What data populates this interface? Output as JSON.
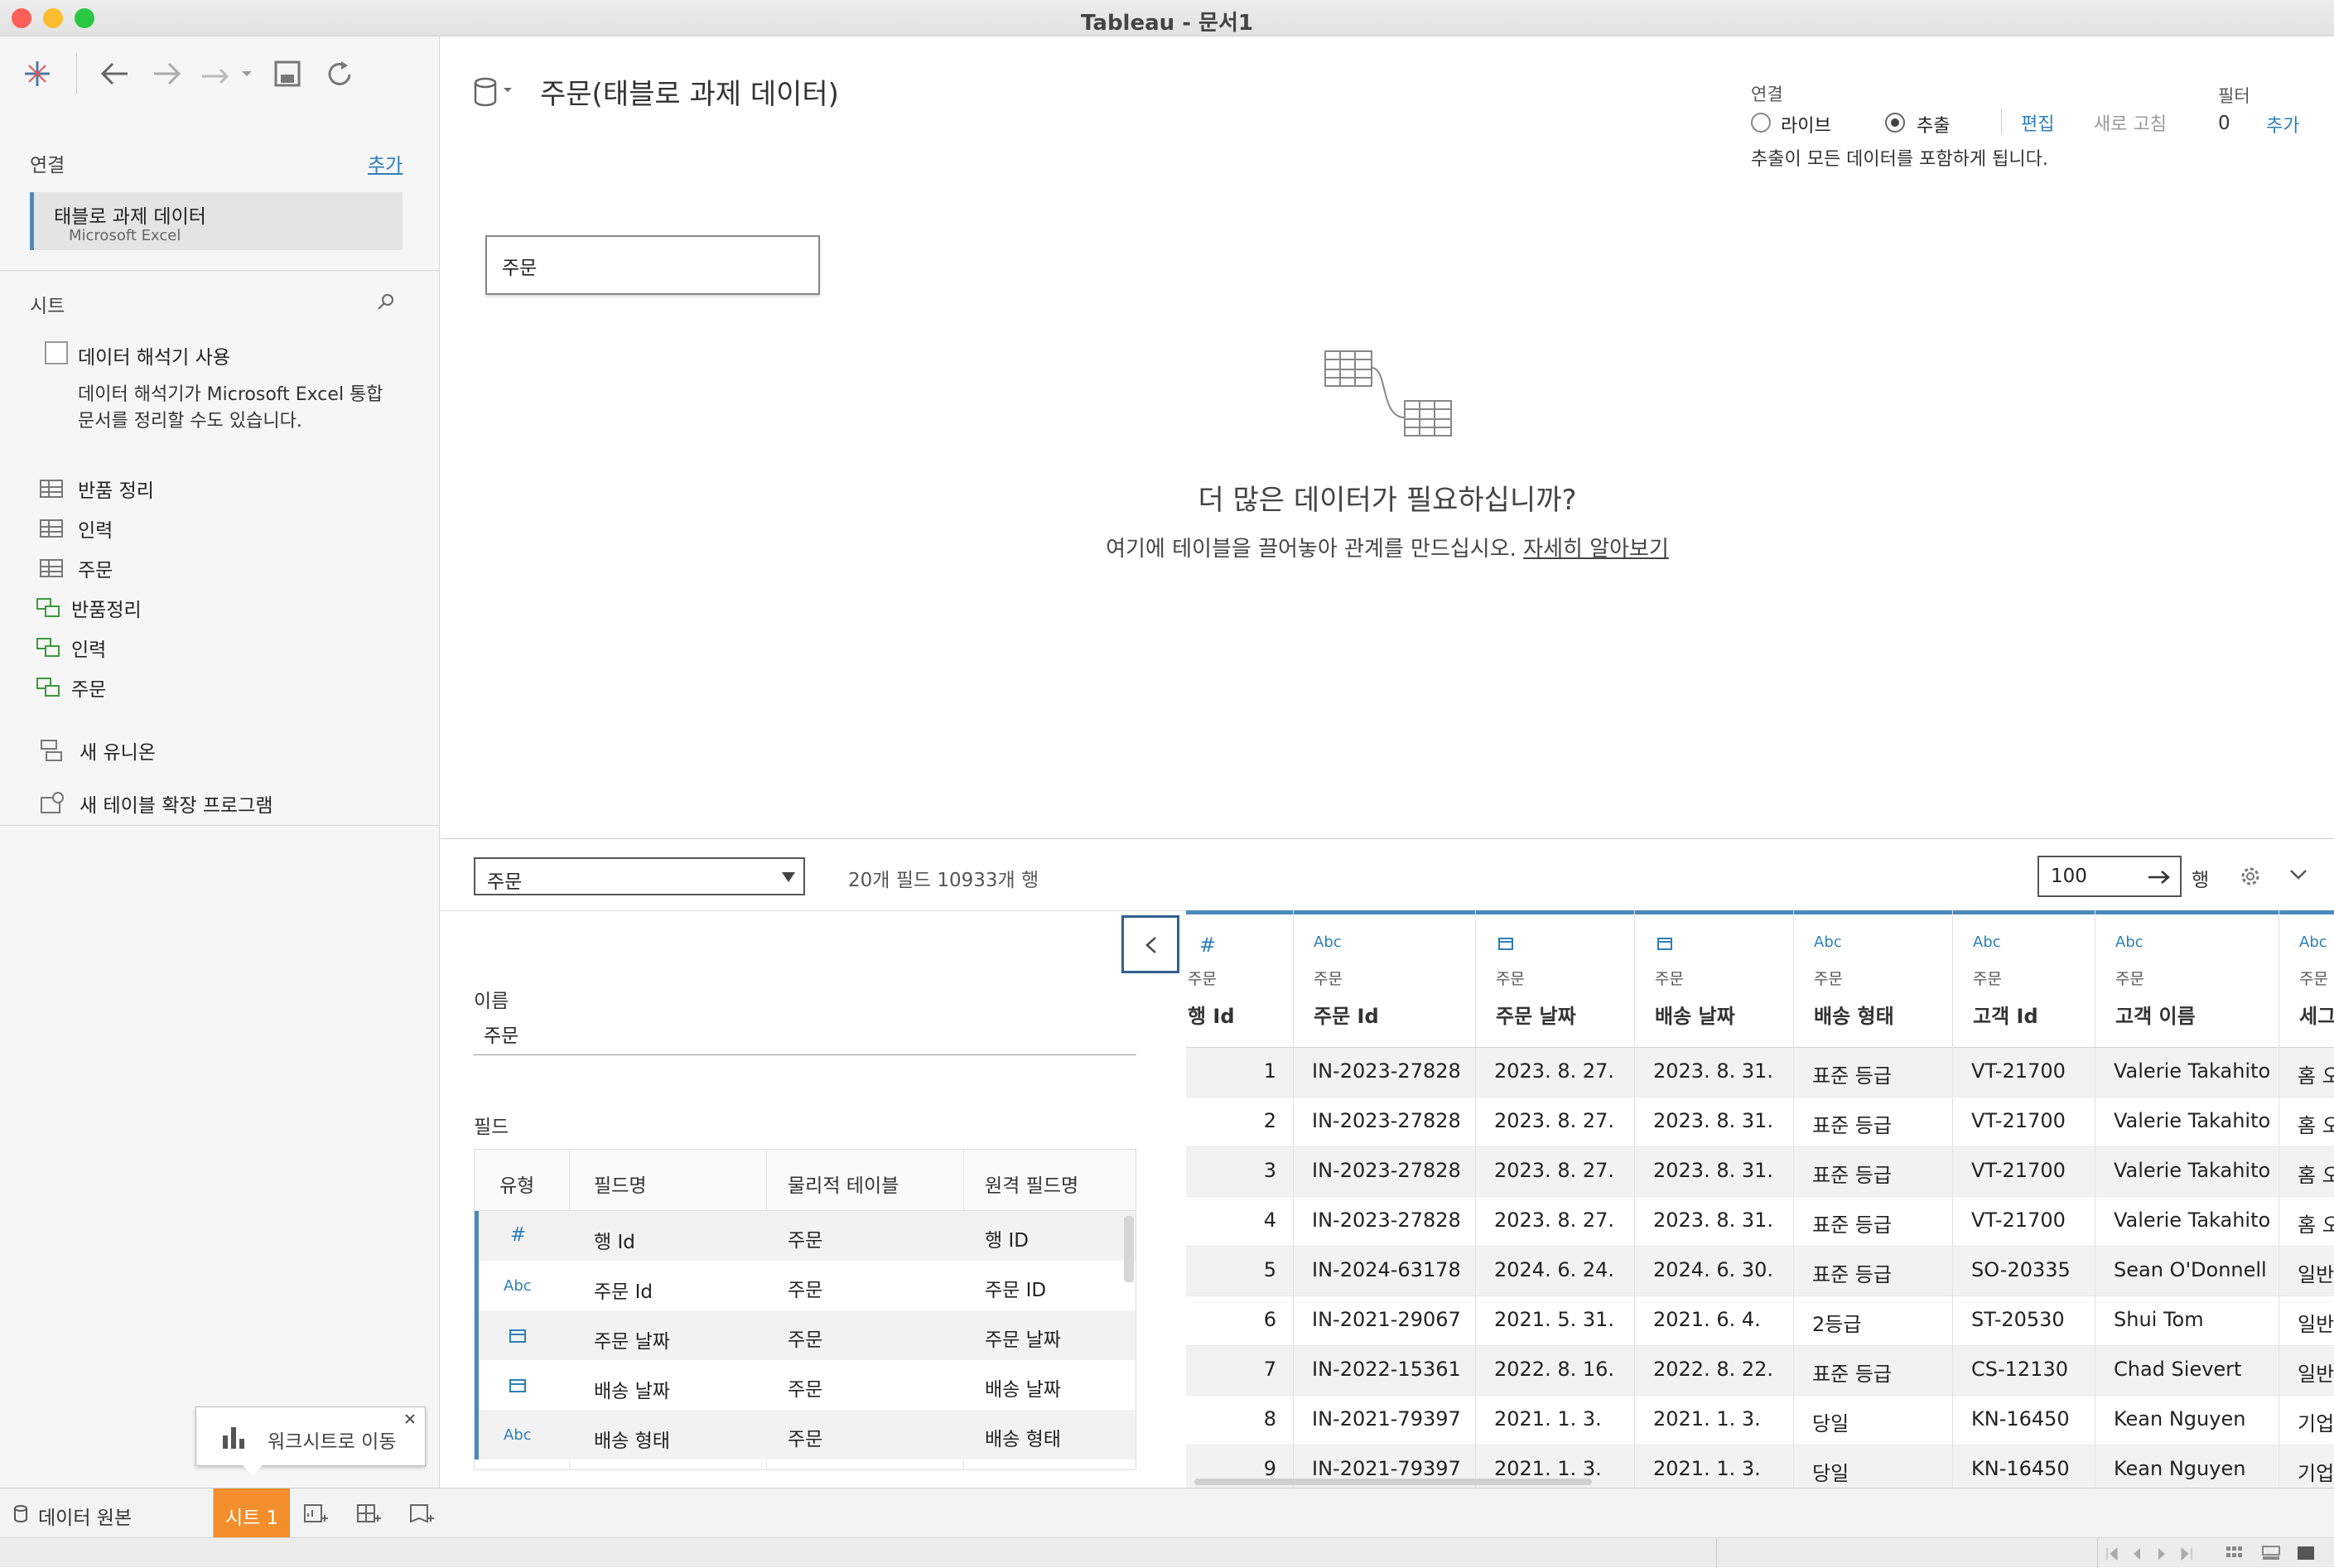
{
  "window": {
    "title": "Tableau - 문서1"
  },
  "left": {
    "connections_label": "연결",
    "add_label": "추가",
    "connection_name": "태블로 과제 데이터",
    "connection_type": "Microsoft Excel",
    "sheets_label": "시트",
    "interpreter_label": "데이터 해석기 사용",
    "interpreter_desc_1": "데이터 해석기가 Microsoft Excel 통합",
    "interpreter_desc_2": "문서를 정리할 수도 있습니다.",
    "sheets": [
      {
        "label": "반품 정리",
        "kind": "table"
      },
      {
        "label": "인력",
        "kind": "table"
      },
      {
        "label": "주문",
        "kind": "table"
      },
      {
        "label": "반품정리",
        "kind": "extension"
      },
      {
        "label": "인력",
        "kind": "extension"
      },
      {
        "label": "주문",
        "kind": "extension"
      }
    ],
    "new_union": "새 유니온",
    "new_extension": "새 테이블 확장 프로그램"
  },
  "canvas": {
    "datasource_title": "주문(태블로 과제 데이터)",
    "conn_label": "연결",
    "live_label": "라이브",
    "extract_label": "추출",
    "edit_label": "편집",
    "refresh_label": "새로 고침",
    "extract_note": "추출이 모든 데이터를 포함하게 됩니다.",
    "filter_label": "필터",
    "filter_count": "0",
    "filter_add": "추가",
    "table_card": "주문",
    "more_data_title": "더 많은 데이터가 필요하십니까?",
    "more_data_desc": "여기에 테이블을 끌어놓아 관계를 만드십시오.",
    "learn_more": "자세히 알아보기"
  },
  "bottom": {
    "table_select": "주문",
    "summary": "20개 필드 10933개 행",
    "rows_value": "100",
    "rows_label": "행",
    "name_label": "이름",
    "name_value": "주문",
    "fields_label": "필드",
    "field_headers": [
      "유형",
      "필드명",
      "물리적 테이블",
      "원격 필드명"
    ],
    "fields": [
      {
        "type": "#",
        "name": "행 Id",
        "table": "주문",
        "remote": "행 ID"
      },
      {
        "type": "Abc",
        "name": "주문 Id",
        "table": "주문",
        "remote": "주문 ID"
      },
      {
        "type": "date",
        "name": "주문 날짜",
        "table": "주문",
        "remote": "주문 날짜"
      },
      {
        "type": "date",
        "name": "배송 날짜",
        "table": "주문",
        "remote": "배송 날짜"
      },
      {
        "type": "Abc",
        "name": "배송 형태",
        "table": "주문",
        "remote": "배송 형태"
      }
    ]
  },
  "grid": {
    "columns": [
      {
        "type": "#",
        "table": "주문",
        "name": "행 Id"
      },
      {
        "type": "Abc",
        "table": "주문",
        "name": "주문 Id"
      },
      {
        "type": "date",
        "table": "주문",
        "name": "주문 날짜"
      },
      {
        "type": "date",
        "table": "주문",
        "name": "배송 날짜"
      },
      {
        "type": "Abc",
        "table": "주문",
        "name": "배송 형태"
      },
      {
        "type": "Abc",
        "table": "주문",
        "name": "고객 Id"
      },
      {
        "type": "Abc",
        "table": "주문",
        "name": "고객 이름"
      },
      {
        "type": "Abc",
        "table": "주문",
        "name": "세그"
      }
    ],
    "rows": [
      [
        "1",
        "IN-2023-27828",
        "2023. 8. 27.",
        "2023. 8. 31.",
        "표준 등급",
        "VT-21700",
        "Valerie Takahito",
        "홈 오"
      ],
      [
        "2",
        "IN-2023-27828",
        "2023. 8. 27.",
        "2023. 8. 31.",
        "표준 등급",
        "VT-21700",
        "Valerie Takahito",
        "홈 오"
      ],
      [
        "3",
        "IN-2023-27828",
        "2023. 8. 27.",
        "2023. 8. 31.",
        "표준 등급",
        "VT-21700",
        "Valerie Takahito",
        "홈 오"
      ],
      [
        "4",
        "IN-2023-27828",
        "2023. 8. 27.",
        "2023. 8. 31.",
        "표준 등급",
        "VT-21700",
        "Valerie Takahito",
        "홈 오"
      ],
      [
        "5",
        "IN-2024-63178",
        "2024. 6. 24.",
        "2024. 6. 30.",
        "표준 등급",
        "SO-20335",
        "Sean O'Donnell",
        "일반"
      ],
      [
        "6",
        "IN-2021-29067",
        "2021. 5. 31.",
        "2021. 6. 4.",
        "2등급",
        "ST-20530",
        "Shui Tom",
        "일반"
      ],
      [
        "7",
        "IN-2022-15361",
        "2022. 8. 16.",
        "2022. 8. 22.",
        "표준 등급",
        "CS-12130",
        "Chad Sievert",
        "일반"
      ],
      [
        "8",
        "IN-2021-79397",
        "2021. 1. 3.",
        "2021. 1. 3.",
        "당일",
        "KN-16450",
        "Kean Nguyen",
        "기업"
      ],
      [
        "9",
        "IN-2021-79397",
        "2021. 1. 3.",
        "2021. 1. 3.",
        "당일",
        "KN-16450",
        "Kean Nguyen",
        "기업"
      ]
    ]
  },
  "tabs": {
    "datasource_tab": "데이터 원본",
    "sheet_tab": "시트 1",
    "tooltip": "워크시트로 이동"
  },
  "colors": {
    "accent": "#2d7fb8",
    "tab_orange": "#f28e2b",
    "selected_bar": "#4a8bbd"
  }
}
